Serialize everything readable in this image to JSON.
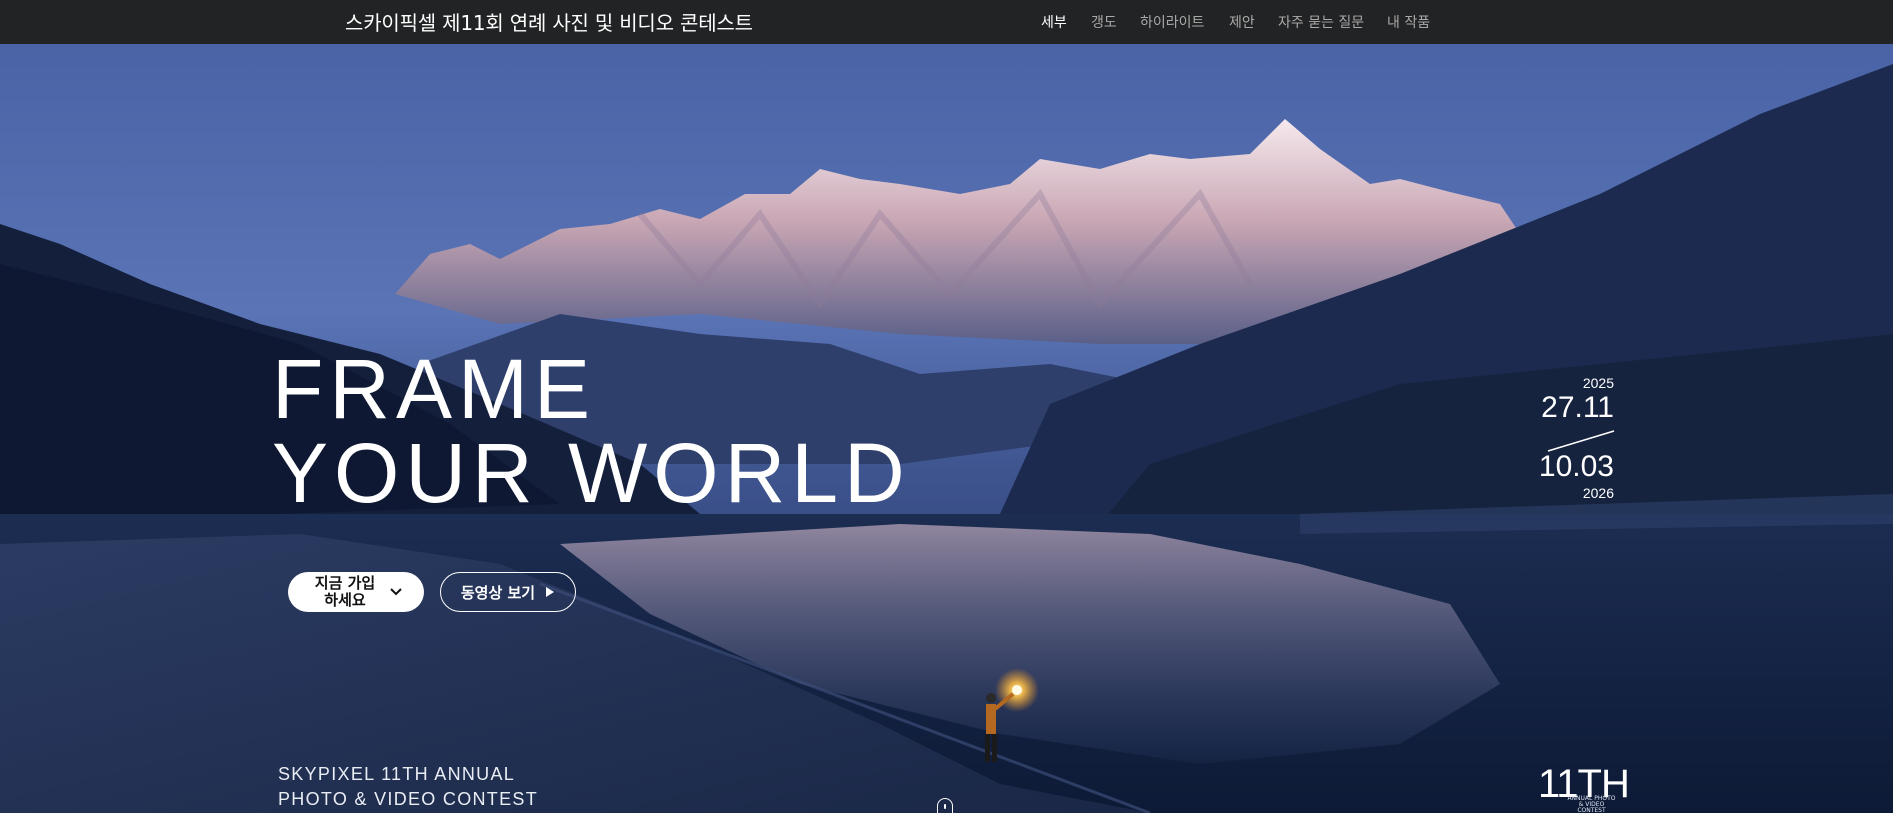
{
  "header": {
    "brand": "스카이픽셀 제11회 연례 사진 및 비디오 콘테스트",
    "nav": [
      {
        "label": "세부",
        "active": true
      },
      {
        "label": "갱도",
        "active": false
      },
      {
        "label": "하이라이트",
        "active": false
      },
      {
        "label": "제안",
        "active": false
      },
      {
        "label": "자주 묻는 질문",
        "active": false
      },
      {
        "label": "내 작품",
        "active": false
      }
    ]
  },
  "hero": {
    "headline_line1": "FRAME",
    "headline_line2": "YOUR WORLD",
    "dates": {
      "start_year": "2025",
      "start_date": "27.11",
      "end_date": "10.03",
      "end_year": "2026"
    },
    "join_button": "지금 가입 하세요",
    "video_button": "동영상 보기",
    "subtitle_line1": "SKYPIXEL 11TH ANNUAL",
    "subtitle_line2": "PHOTO & VIDEO CONTEST",
    "badge": {
      "big": "11TH",
      "small": "ANNUAL PHOTO & VIDEO CONTEST"
    }
  },
  "icons": {
    "join_chevron": "chevron-down-icon",
    "video_play": "play-icon",
    "scroll": "scroll-mouse-icon"
  },
  "colors": {
    "topbar": "#222324",
    "sky_top": "#4a64a8",
    "lake": "#13233f",
    "text": "#ffffff"
  }
}
